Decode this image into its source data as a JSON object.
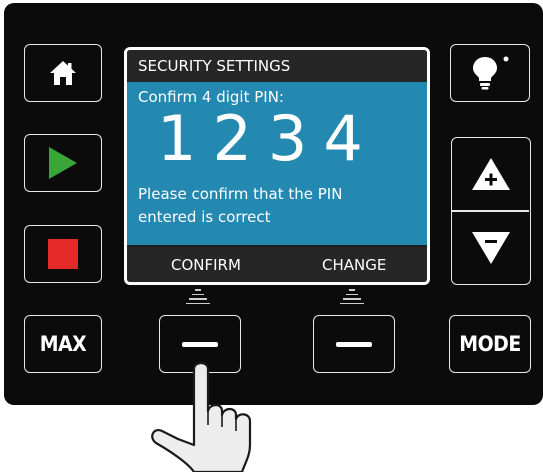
{
  "screen": {
    "title": "SECURITY SETTINGS",
    "prompt": "Confirm 4 digit PIN:",
    "pin": "1234",
    "message": "Please confirm that the PIN entered is correct",
    "softkeys": {
      "left": "CONFIRM",
      "right": "CHANGE"
    }
  },
  "buttons": {
    "max_label": "MAX",
    "mode_label": "MODE"
  },
  "icons": {
    "home": "home-icon",
    "play": "play-icon",
    "stop": "stop-icon",
    "light": "light-bulb-icon",
    "plus": "plus-icon",
    "minus": "minus-icon",
    "pointer": "hand-pointer-icon"
  },
  "colors": {
    "screen_body": "#2389b1",
    "play": "#3aa63a",
    "stop": "#e52a2a",
    "panel": "#0b0b0b"
  }
}
